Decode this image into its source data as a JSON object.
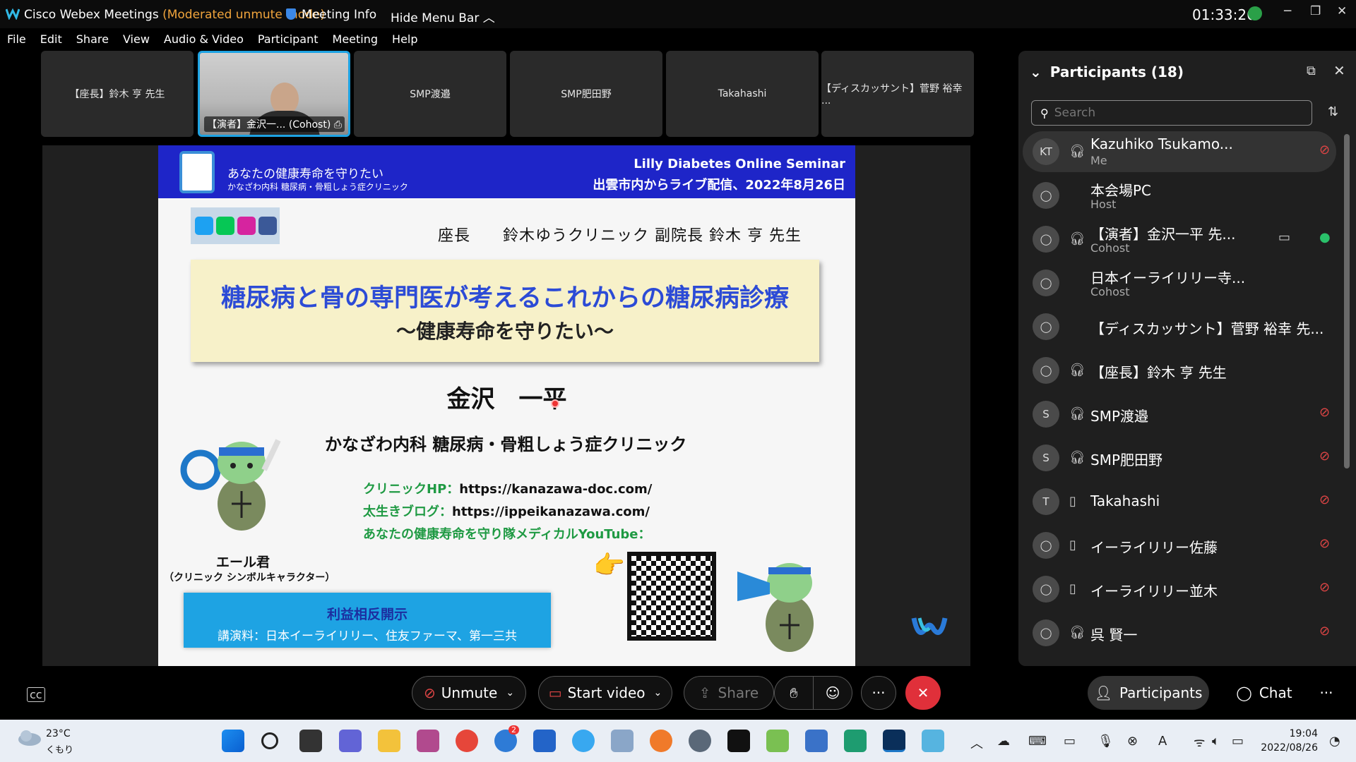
{
  "titlebar": {
    "app_name": "Cisco Webex Meetings",
    "mode": "(Moderated unmute mode)",
    "meeting_info": "Meeting Info",
    "hide_menu": "Hide Menu Bar",
    "clock": "01:33:26",
    "minimize": "─",
    "restore": "❐",
    "close": "✕"
  },
  "menu": [
    "File",
    "Edit",
    "Share",
    "View",
    "Audio & Video",
    "Participant",
    "Meeting",
    "Help"
  ],
  "thumbnails": [
    "【座長】鈴木 亨 先生",
    "【演者】金沢一...",
    "SMP渡邉",
    "SMP肥田野",
    "Takahashi",
    "【ディスカッサント】菅野 裕幸 ..."
  ],
  "thumb_active_cohost": "(Cohost)",
  "slide": {
    "banner_title": "あなたの健康寿命を守りたい",
    "banner_sub": "かなざわ内科 糖尿病・骨粗しょう症クリニック",
    "seminar": "Lilly Diabetes Online Seminar",
    "broadcast": "出雲市内からライブ配信、2022年8月26日",
    "chair": "座長　　鈴木ゆうクリニック 副院長 鈴木 亨 先生",
    "title_main": "糖尿病と骨の専門医が考えるこれからの糖尿病診療",
    "title_sub": "～健康寿命を守りたい～",
    "speaker": "金沢　一平",
    "clinic": "かなざわ内科 糖尿病・骨粗しょう症クリニック",
    "link1_label": "クリニックHP：",
    "link1_url": "https://kanazawa-doc.com/",
    "link2_label": "太生きブログ：",
    "link2_url": "https://ippeikanazawa.com/",
    "link3_label": "あなたの健康寿命を守り隊メディカルYouTube：",
    "mascot_name": "エール君",
    "mascot_caption": "（クリニック シンボルキャラクター）",
    "coi_title": "利益相反開示",
    "coi_body": "講演料：日本イーライリリー、住友ファーマ、第一三共"
  },
  "panel": {
    "title": "Participants (18)",
    "search_placeholder": "Search",
    "participants": [
      {
        "initials": "KT",
        "name": "Kazuhiko Tsukamo...",
        "role": "Me",
        "device": "headset",
        "status": "muted"
      },
      {
        "initials": "",
        "name": "本会場PC",
        "role": "Host",
        "device": "",
        "status": ""
      },
      {
        "initials": "",
        "name": "【演者】金沢一平 先...",
        "role": "Cohost",
        "device": "headset",
        "status": "mic-on"
      },
      {
        "initials": "",
        "name": "日本イーライリリー寺...",
        "role": "Cohost",
        "device": "",
        "status": ""
      },
      {
        "initials": "",
        "name": "【ディスカッサント】菅野 裕幸 先...",
        "role": "",
        "device": "",
        "status": ""
      },
      {
        "initials": "",
        "name": "【座長】鈴木 亨 先生",
        "role": "",
        "device": "headset",
        "status": ""
      },
      {
        "initials": "S",
        "name": "SMP渡邉",
        "role": "",
        "device": "headset",
        "status": "muted"
      },
      {
        "initials": "S",
        "name": "SMP肥田野",
        "role": "",
        "device": "headset",
        "status": "muted"
      },
      {
        "initials": "T",
        "name": "Takahashi",
        "role": "",
        "device": "phone",
        "status": "muted"
      },
      {
        "initials": "",
        "name": "イーライリリー佐藤",
        "role": "",
        "device": "phone",
        "status": "muted"
      },
      {
        "initials": "",
        "name": "イーライリリー並木",
        "role": "",
        "device": "phone",
        "status": "muted"
      },
      {
        "initials": "",
        "name": "呉 賢一",
        "role": "",
        "device": "headset",
        "status": "muted"
      }
    ]
  },
  "controls": {
    "unmute": "Unmute",
    "start_video": "Start video",
    "share": "Share",
    "more": "···",
    "participants": "Participants",
    "chat": "Chat",
    "overflow": "···"
  },
  "taskbar": {
    "temp": "23°C",
    "condition": "くもり",
    "time": "19:04",
    "date": "2022/08/26",
    "badge": "2"
  },
  "colors": {
    "accent": "#1ea3e3",
    "mute_red": "#e04545",
    "end_red": "#e0303a",
    "mode_orange": "#f0a43c"
  }
}
